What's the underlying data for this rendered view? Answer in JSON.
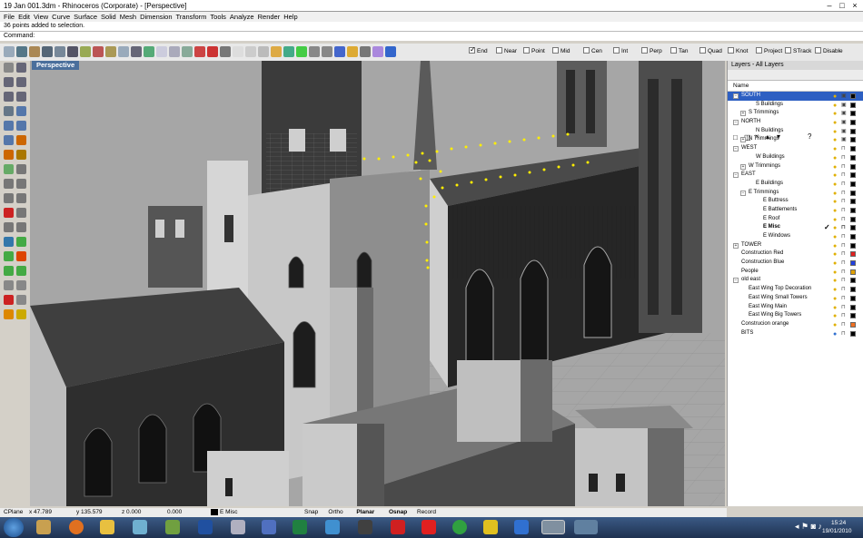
{
  "window": {
    "title": "19 Jan 001.3dm - Rhinoceros (Corporate) - [Perspective]"
  },
  "menu": [
    "File",
    "Edit",
    "View",
    "Curve",
    "Surface",
    "Solid",
    "Mesh",
    "Dimension",
    "Transform",
    "Tools",
    "Analyze",
    "Render",
    "Help"
  ],
  "command": {
    "history": "36 points added to selection.",
    "prompt": "Command:",
    "value": ""
  },
  "osnaps": [
    {
      "label": "End",
      "checked": true
    },
    {
      "label": "Near",
      "checked": false
    },
    {
      "label": "Point",
      "checked": false
    },
    {
      "label": "Mid",
      "checked": false
    },
    {
      "label": "Cen",
      "checked": false
    },
    {
      "label": "Int",
      "checked": false
    },
    {
      "label": "Perp",
      "checked": false
    },
    {
      "label": "Tan",
      "checked": false
    },
    {
      "label": "Quad",
      "checked": false
    },
    {
      "label": "Knot",
      "checked": false
    },
    {
      "label": "Project",
      "checked": false
    },
    {
      "label": "STrack",
      "checked": false
    },
    {
      "label": "Disable",
      "checked": false
    }
  ],
  "viewport": {
    "label": "Perspective"
  },
  "layers": {
    "title": "Layers - All Layers",
    "column": "Name",
    "rows": [
      {
        "name": "SOUTH",
        "indent": 0,
        "expand": "−",
        "color": "#000000",
        "selected": true,
        "unlocked": false
      },
      {
        "name": "S Buildings",
        "indent": 2,
        "expand": "",
        "color": "#000000",
        "unlocked": false
      },
      {
        "name": "S Trimmings",
        "indent": 1,
        "expand": "+",
        "color": "#000000",
        "unlocked": false
      },
      {
        "name": "NORTH",
        "indent": 0,
        "expand": "−",
        "color": "#000000",
        "unlocked": false
      },
      {
        "name": "N Buildings",
        "indent": 2,
        "expand": "",
        "color": "#000000",
        "unlocked": false
      },
      {
        "name": "N Trimmings",
        "indent": 1,
        "expand": "+",
        "color": "#000000",
        "unlocked": false
      },
      {
        "name": "WEST",
        "indent": 0,
        "expand": "−",
        "color": "#000000",
        "unlocked": true
      },
      {
        "name": "W Buildings",
        "indent": 2,
        "expand": "",
        "color": "#000000",
        "unlocked": true
      },
      {
        "name": "W Trimmings",
        "indent": 1,
        "expand": "+",
        "color": "#000000",
        "unlocked": true
      },
      {
        "name": "EAST",
        "indent": 0,
        "expand": "−",
        "color": "#000000",
        "unlocked": true
      },
      {
        "name": "E Buildings",
        "indent": 2,
        "expand": "",
        "color": "#000000",
        "unlocked": true
      },
      {
        "name": "E Trimmings",
        "indent": 1,
        "expand": "−",
        "color": "#000000",
        "unlocked": true
      },
      {
        "name": "E Buttress",
        "indent": 3,
        "expand": "",
        "color": "#000000",
        "unlocked": true
      },
      {
        "name": "E Battlements",
        "indent": 3,
        "expand": "",
        "color": "#000000",
        "unlocked": true
      },
      {
        "name": "E Roof",
        "indent": 3,
        "expand": "",
        "color": "#000000",
        "unlocked": true
      },
      {
        "name": "E Misc",
        "indent": 3,
        "expand": "",
        "color": "#000000",
        "current": true,
        "unlocked": true
      },
      {
        "name": "E Windows",
        "indent": 3,
        "expand": "",
        "color": "#000000",
        "unlocked": true
      },
      {
        "name": "TOWER",
        "indent": 0,
        "expand": "+",
        "color": "#000000",
        "unlocked": true
      },
      {
        "name": "Construction Red",
        "indent": 0,
        "expand": "",
        "color": "#e02020",
        "unlocked": true
      },
      {
        "name": "Construction Blue",
        "indent": 0,
        "expand": "",
        "color": "#2040e0",
        "unlocked": true
      },
      {
        "name": "People",
        "indent": 0,
        "expand": "",
        "color": "#e0a000",
        "unlocked": true
      },
      {
        "name": "old east",
        "indent": 0,
        "expand": "−",
        "color": "#000000",
        "unlocked": true
      },
      {
        "name": "East Wing Top Decoration",
        "indent": 1,
        "expand": "",
        "color": "#000000",
        "unlocked": true
      },
      {
        "name": "East Wing Small Towers",
        "indent": 1,
        "expand": "",
        "color": "#000000",
        "unlocked": true
      },
      {
        "name": "East Wing Main",
        "indent": 1,
        "expand": "",
        "color": "#000000",
        "unlocked": true
      },
      {
        "name": "East Wing Big Towers",
        "indent": 1,
        "expand": "",
        "color": "#000000",
        "unlocked": true
      },
      {
        "name": "Construcion orange",
        "indent": 0,
        "expand": "",
        "color": "#f07020",
        "unlocked": true
      },
      {
        "name": "BITS",
        "indent": 0,
        "expand": "",
        "color": "#000000",
        "bulb": "blue",
        "unlocked": true
      }
    ]
  },
  "status": {
    "cplane": "CPlane",
    "x": "x 47.789",
    "y": "y 135.579",
    "z": "z 0.000",
    "extra": "0.000",
    "layer": "E Misc",
    "toggles": [
      "Snap",
      "Ortho",
      "Planar",
      "Osnap",
      "Record History"
    ]
  },
  "taskbar": {
    "time": "15:24",
    "date": "19/01/2010"
  }
}
